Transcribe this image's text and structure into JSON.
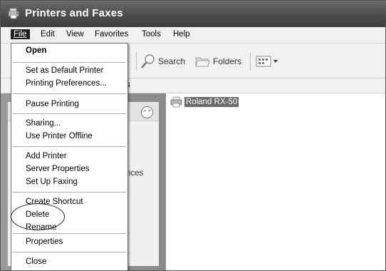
{
  "window": {
    "title": "Printers and Faxes"
  },
  "menubar": {
    "items": [
      "File",
      "Edit",
      "View",
      "Favorites",
      "Tools",
      "Help"
    ]
  },
  "toolbar": {
    "search_label": "Search",
    "folders_label": "Folders"
  },
  "address": {
    "fragment": "s"
  },
  "leftpane": {
    "fragment": "nces"
  },
  "printer": {
    "name": "Roland RX-50"
  },
  "file_menu": {
    "items": [
      "Open",
      "Set as Default Printer",
      "Printing Preferences...",
      "Pause Printing",
      "Sharing...",
      "Use Printer Offline",
      "Add Printer",
      "Server Properties",
      "Set Up Faxing",
      "Create Shortcut",
      "Delete",
      "Rename",
      "Properties",
      "Close"
    ]
  },
  "colors": {
    "titlebar": "#4a4a4a",
    "selection": "#6a6a6a",
    "menu_active": "#1f1f1f"
  }
}
